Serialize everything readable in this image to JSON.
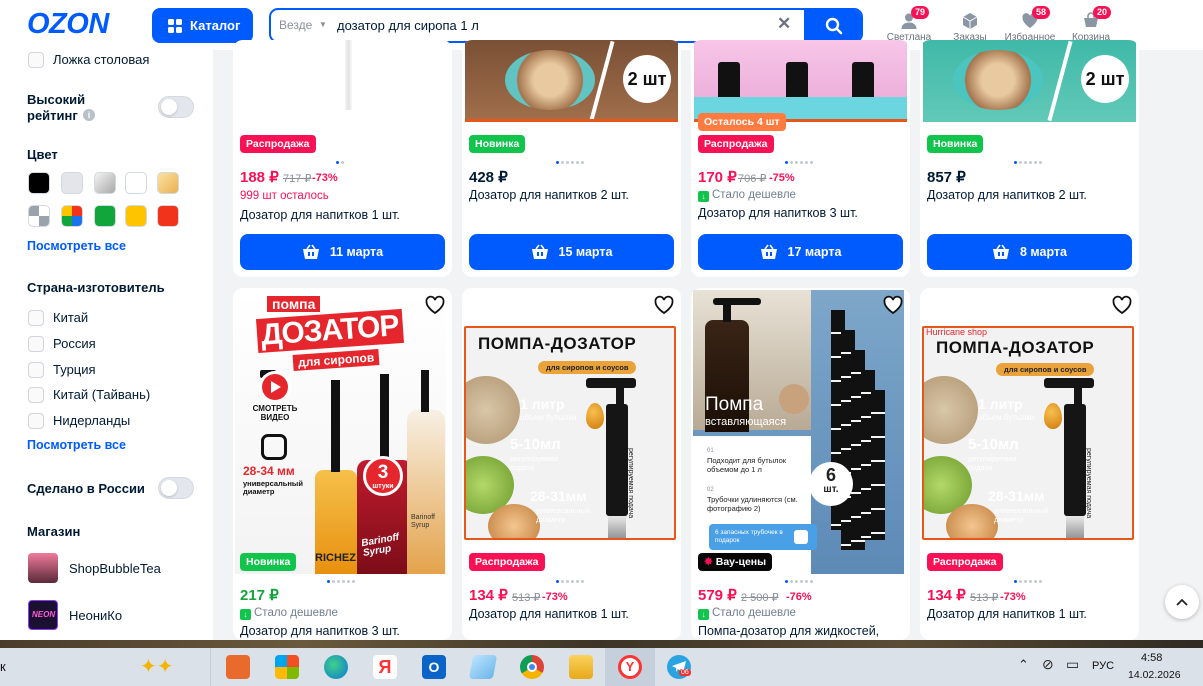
{
  "header": {
    "logo": "OZON",
    "catalog_label": "Каталог",
    "search_scope": "Везде",
    "search_value": "дозатор для сиропа 1 л",
    "profile": {
      "label": "Светлана",
      "badge": "79"
    },
    "orders": {
      "label": "Заказы"
    },
    "favorites": {
      "label": "Избранное",
      "badge": "58"
    },
    "cart": {
      "label": "Корзина",
      "badge": "20"
    }
  },
  "sidebar": {
    "spoon_label": "Ложка столовая",
    "high_rating_label_1": "Высокий",
    "high_rating_label_2": "рейтинг",
    "color_title": "Цвет",
    "colors": [
      "#000000",
      "#e3e5ea",
      "#c8c8c8",
      "#ffffff",
      "#f3c77a",
      "checkered",
      "multicolor",
      "#10a63c",
      "#ffc400",
      "#f0331a"
    ],
    "see_all_colors": "Посмотреть все",
    "country_title": "Страна-изготовитель",
    "countries": [
      "Китай",
      "Россия",
      "Турция",
      "Китай (Тайвань)",
      "Нидерланды"
    ],
    "see_all_countries": "Посмотреть все",
    "made_in_russia": "Сделано в России",
    "shop_title": "Магазин",
    "shops": [
      "ShopBubbleTea",
      "НеониКо"
    ]
  },
  "products_row1": [
    {
      "tag": "Распродажа",
      "price": "188 ₽",
      "old_price": "717 ₽",
      "discount": "-73%",
      "note": "999 шт осталось",
      "title": "Дозатор для напитков 1 шт.",
      "delivery": "11 марта"
    },
    {
      "tag": "Новинка",
      "price": "428 ₽",
      "title": "Дозатор для напитков 2 шт.",
      "delivery": "15 марта",
      "image_badge": "2 шт"
    },
    {
      "tag": "Распродажа",
      "extra_tag": "Осталось 4 шт",
      "price": "170 ₽",
      "old_price": "706 ₽",
      "discount": "-75%",
      "note": "Стало дешевле",
      "title": "Дозатор для напитков 3 шт.",
      "delivery": "17 марта"
    },
    {
      "tag": "Новинка",
      "price": "857 ₽",
      "title": "Дозатор для напитков 2 шт.",
      "delivery": "8 марта",
      "image_badge": "2 шт"
    }
  ],
  "products_row2": [
    {
      "tag": "Новинка",
      "price": "217 ₽",
      "note": "Стало дешевле",
      "title": "Дозатор для напитков 3 шт.",
      "image": {
        "line1": "помпа",
        "line2": "ДОЗАТОР",
        "line3": "для сиропов",
        "video": "СМОТРЕТЬ ВИДЕО",
        "size": "28-34 мм",
        "size_sub": "универсальный диаметр",
        "count": "3",
        "count_sub": "штуки",
        "bottle1": "RICHEZ",
        "bottle2": "Barinoff Syrup",
        "bottle3": "Barinoff Syrup"
      }
    },
    {
      "tag": "Распродажа",
      "price": "134 ₽",
      "old_price": "513 ₽",
      "discount": "-73%",
      "title": "Дозатор для напитков 1 шт.",
      "image": {
        "title": "ПОМПА-ДОЗАТОР",
        "sub": "для сиропов и соусов",
        "vol": "1 литр",
        "vol_sub": "объем бутылки",
        "dose": "5-10мл",
        "dose_sub": "регулируемая подача",
        "diam": "28-31мм",
        "diam_sub": "универсальный диаметр",
        "side": "регулируемая подача"
      }
    },
    {
      "tag": "Вау-цены",
      "price": "579 ₽",
      "old_price": "2 500 ₽",
      "discount": "-76%",
      "note": "Стало дешевле",
      "title": "Помпа-дозатор для жидкостей,",
      "image": {
        "title": "Помпа",
        "sub": "вставляющаяся",
        "n1": "01",
        "f1": "Подходит для бутылок объемом до 1 л",
        "n2": "02",
        "f2": "Трубочки удлиняются (см. фотографию 2)",
        "gift": "6 запасных трубочек в подарок",
        "count": "6",
        "count_sub": "шт."
      }
    },
    {
      "tag": "Распродажа",
      "price": "134 ₽",
      "old_price": "513 ₽",
      "discount": "-73%",
      "title": "Дозатор для напитков 1 шт.",
      "image": {
        "shop": "Hurricane shop",
        "title": "ПОМПА-ДОЗАТОР",
        "sub": "для сиропов и соусов",
        "vol": "1 литр",
        "vol_sub": "объем бутылки",
        "dose": "5-10мл",
        "dose_sub": "регулируемая подача",
        "diam": "28-31мм",
        "diam_sub": "универсальный диаметр",
        "side": "регулируемая подача"
      }
    }
  ],
  "taskbar": {
    "left_char": "к",
    "lang": "РУС",
    "time": "4:58",
    "date": "14.02.2026",
    "telegram_badge": "06"
  }
}
